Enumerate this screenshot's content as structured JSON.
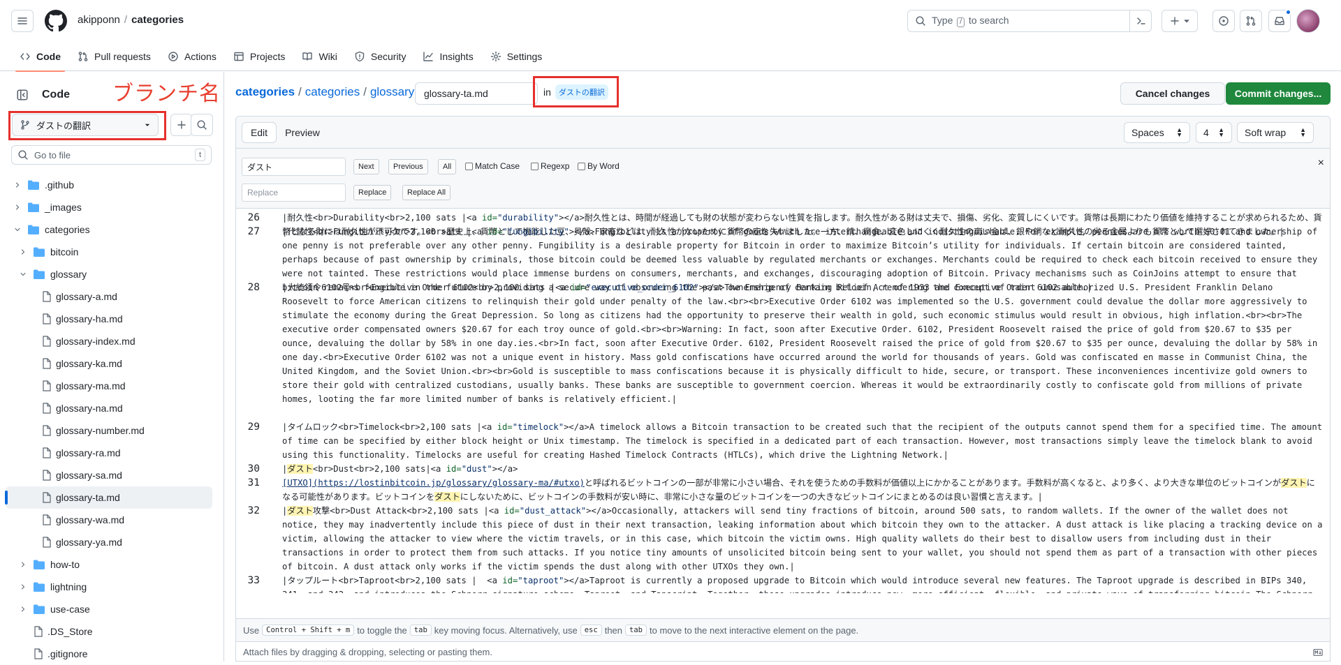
{
  "header": {
    "owner": "akipponn",
    "repo": "categories",
    "search_placeholder_pre": "Type",
    "search_key": "/",
    "search_placeholder_post": "to search"
  },
  "nav": [
    {
      "label": "Code",
      "icon": "code-icon",
      "active": true
    },
    {
      "label": "Pull requests",
      "icon": "pull-request-icon"
    },
    {
      "label": "Actions",
      "icon": "play-icon"
    },
    {
      "label": "Projects",
      "icon": "table-icon"
    },
    {
      "label": "Wiki",
      "icon": "book-icon"
    },
    {
      "label": "Security",
      "icon": "shield-icon"
    },
    {
      "label": "Insights",
      "icon": "graph-icon"
    },
    {
      "label": "Settings",
      "icon": "gear-icon"
    }
  ],
  "sidebar": {
    "title": "Code",
    "annotation": "ブランチ名",
    "branch": "ダストの翻訳",
    "goto_placeholder": "Go to file",
    "goto_key": "t",
    "tree": [
      {
        "label": ".github",
        "type": "dir",
        "depth": 0,
        "open": false
      },
      {
        "label": "_images",
        "type": "dir",
        "depth": 0,
        "open": false
      },
      {
        "label": "categories",
        "type": "dir",
        "depth": 0,
        "open": true
      },
      {
        "label": "bitcoin",
        "type": "dir",
        "depth": 1,
        "open": false
      },
      {
        "label": "glossary",
        "type": "dir",
        "depth": 1,
        "open": true
      },
      {
        "label": "glossary-a.md",
        "type": "file",
        "depth": 2
      },
      {
        "label": "glossary-ha.md",
        "type": "file",
        "depth": 2
      },
      {
        "label": "glossary-index.md",
        "type": "file",
        "depth": 2
      },
      {
        "label": "glossary-ka.md",
        "type": "file",
        "depth": 2
      },
      {
        "label": "glossary-ma.md",
        "type": "file",
        "depth": 2
      },
      {
        "label": "glossary-na.md",
        "type": "file",
        "depth": 2
      },
      {
        "label": "glossary-number.md",
        "type": "file",
        "depth": 2
      },
      {
        "label": "glossary-ra.md",
        "type": "file",
        "depth": 2
      },
      {
        "label": "glossary-sa.md",
        "type": "file",
        "depth": 2
      },
      {
        "label": "glossary-ta.md",
        "type": "file",
        "depth": 2,
        "selected": true
      },
      {
        "label": "glossary-wa.md",
        "type": "file",
        "depth": 2
      },
      {
        "label": "glossary-ya.md",
        "type": "file",
        "depth": 2
      },
      {
        "label": "how-to",
        "type": "dir",
        "depth": 1,
        "open": false
      },
      {
        "label": "lightning",
        "type": "dir",
        "depth": 1,
        "open": false
      },
      {
        "label": "use-case",
        "type": "dir",
        "depth": 1,
        "open": false
      },
      {
        "label": ".DS_Store",
        "type": "file",
        "depth": 1
      },
      {
        "label": ".gitignore",
        "type": "file",
        "depth": 1
      }
    ]
  },
  "main": {
    "breadcrumbs": [
      "categories",
      "categories",
      "glossary"
    ],
    "filename": "glossary-ta.md",
    "in_label": "in",
    "branch_chip": "ダストの翻訳",
    "cancel_label": "Cancel changes",
    "commit_label": "Commit changes..."
  },
  "editor": {
    "tab_edit": "Edit",
    "tab_preview": "Preview",
    "indent_mode": "Spaces",
    "indent_size": "4",
    "wrap_mode": "Soft wrap",
    "find": {
      "value": "ダスト",
      "replace_placeholder": "Replace",
      "next": "Next",
      "previous": "Previous",
      "all": "All",
      "match_case": "Match Case",
      "regexp": "Regexp",
      "by_word": "By Word",
      "replace": "Replace",
      "replace_all": "Replace All",
      "close": "×"
    },
    "lines": [
      {
        "n": "26",
        "parts": [
          [
            "t",
            "|耐久性<br>Durability<br>2,100 sats |<a "
          ],
          [
            "a",
            "id="
          ],
          [
            "s",
            "\"durability\""
          ],
          [
            "t",
            "></a>耐久性とは、時間が経過しても財の状態が変わらない性質を指します。耐久性がある財は丈夫で、損傷、劣化、変質しにくいです。貨幣は長期にわたり価値を維持することが求められるため、貨幣となる財には耐久性が不可欠です。<br>歴史上、貨幣として機能した豆、貝殻、家畜などは、耐久性がないために貨幣の座を失いました。一方、錆、腐食、変色しにくく耐久性の高い金は、銀や銅など耐久性の劣る金属よりも貨幣として選好されてきました。|"
          ]
        ]
      },
      {
        "n": "27",
        "parts": [
          [
            "t",
            "|代替性<br>Fungibility<br>2,100 sats |<a "
          ],
          [
            "a",
            "id="
          ],
          [
            "s",
            "\"fungibility\""
          ],
          [
            "t",
            "></a>Fungibility is a property of goods which are interchangeable and indistinguishable. For example, pennies are all worth $0.01 and ownership of one penny is not preferable over any other penny. Fungibility is a desirable property for Bitcoin in order to maximize Bitcoin’s utility for individuals. If certain bitcoin are considered tainted, perhaps because of past ownership by criminals, those bitcoin could be deemed less valuable by regulated merchants or exchanges. Merchants could be required to check each bitcoin received to ensure they were not tainted. These restrictions would place immense burdens on consumers, merchants, and exchanges, discouraging adoption of Bitcoin. Privacy mechanisms such as CoinJoins attempt to ensure that bitcoin remains fungible in the future by providing a secure way of obscuring the past ownership of certain bitcoin, rendering the concept of taint unusable.|"
          ]
        ]
      },
      {
        "n": "28",
        "parts": [
          [
            "t",
            "|大統領令6102号<br>Executive Order 6102<br>2,100 sats |<a "
          ],
          [
            "a",
            "id="
          ],
          [
            "s",
            "\"executive_order_6102\""
          ],
          [
            "t",
            "></a>The Emergency Banking Relief Act of 1933 and Executive Order 6102 authorized U.S. President Franklin Delano Roosevelt to force American citizens to relinquish their gold under penalty of the law.<br><br>Executive Order 6102 was implemented so the U.S. government could devalue the dollar more aggressively to stimulate the economy during the Great Depression. So long as citizens had the opportunity to preserve their wealth in gold, such economic stimulus would result in obvious, high inflation.<br><br>The executive order compensated owners $20.67 for each troy ounce of gold.<br><br>Warning: In fact, soon after Executive Order. 6102, President Roosevelt raised the price of gold from $20.67 to $35 per ounce, devaluing the dollar by 58% in one day.ies.<br>In fact, soon after Executive Order. 6102, President Roosevelt raised the price of gold from $20.67 to $35 per ounce, devaluing the dollar by 58% in one day.<br>Executive Order 6102 was not a unique event in history. Mass gold confiscations have occurred around the world for thousands of years. Gold was confiscated en masse in Communist China, the United Kingdom, and the Soviet Union.<br><br>Gold is susceptible to mass confiscations because it is physically difficult to hide, secure, or transport. These inconveniences incentivize gold owners to store their gold with centralized custodians, usually banks. These banks are susceptible to government coercion. Whereas it would be extraordinarily costly to confiscate gold from millions of private homes, looting the far more limited number of banks is relatively efficient.|"
          ]
        ]
      },
      {
        "n": "29",
        "parts": [
          [
            "t",
            "|タイムロック<br>Timelock<br>2,100 sats |<a "
          ],
          [
            "a",
            "id="
          ],
          [
            "s",
            "\"timelock\""
          ],
          [
            "t",
            "></a>A timelock allows a Bitcoin transaction to be created such that the recipient of the outputs cannot spend them for a specified time. The amount of time can be specified by either block height or Unix timestamp. The timelock is specified in a dedicated part of each transaction. However, most transactions simply leave the timelock blank to avoid using this functionality. Timelocks are useful for creating Hashed Timelock Contracts (HTLCs), which drive the Lightning Network.|"
          ]
        ]
      },
      {
        "n": "30",
        "parts": [
          [
            "t",
            "|"
          ],
          [
            "h",
            "ダスト"
          ],
          [
            "t",
            "<br>Dust<br>2,100 sats|<a "
          ],
          [
            "a",
            "id="
          ],
          [
            "s",
            "\"dust\""
          ],
          [
            "t",
            "></a>"
          ]
        ]
      },
      {
        "n": "31",
        "parts": [
          [
            "l",
            "[UTXO](https://lostinbitcoin.jp/glossary/glossary-ma/#utxo)"
          ],
          [
            "t",
            "と呼ばれるビットコインの一部が非常に小さい場合、それを使うための手数料が価値以上にかかることがあります。手数料が高くなると、より多く、より大きな単位のビットコインが"
          ],
          [
            "h",
            "ダスト"
          ],
          [
            "t",
            "になる可能性があります。ビットコインを"
          ],
          [
            "h",
            "ダスト"
          ],
          [
            "t",
            "にしないために、ビットコインの手数料が安い時に、非常に小さな量のビットコインを一つの大きなビットコインにまとめるのは良い習慣と言えます。|"
          ]
        ]
      },
      {
        "n": "32",
        "parts": [
          [
            "t",
            "|"
          ],
          [
            "h",
            "ダスト"
          ],
          [
            "t",
            "攻撃<br>Dust Attack<br>2,100 sats |<a "
          ],
          [
            "a",
            "id="
          ],
          [
            "s",
            "\"dust_attack\""
          ],
          [
            "t",
            "></a>Occasionally, attackers will send tiny fractions of bitcoin, around 500 sats, to random wallets. If the owner of the wallet does not notice, they may inadvertently include this piece of dust in their next transaction, leaking information about which bitcoin they own to the attacker. A dust attack is like placing a tracking device on a victim, allowing the attacker to view where the victim travels, or in this case, which bitcoin the victim owns. High quality wallets do their best to disallow users from including dust in their transactions in order to protect them from such attacks. If you notice tiny amounts of unsolicited bitcoin being sent to your wallet, you should not spend them as part of a transaction with other pieces of bitcoin. A dust attack only works if the victim spends the dust along with other UTXOs they own.|"
          ]
        ]
      },
      {
        "n": "33",
        "parts": [
          [
            "t",
            "|タップルート<br>Taproot<br>2,100 sats |  <a "
          ],
          [
            "a",
            "id="
          ],
          [
            "s",
            "\"taproot\""
          ],
          [
            "t",
            "></a>Taproot is currently a proposed upgrade to Bitcoin which would introduce several new features. The Taproot upgrade is described in BIPs 340, 341, and 342, and introduces the Schnorr signature scheme, Taproot, and Tapscript. Together, these upgrades introduce new, more efficient, flexible, and private ways of transferring bitcoin.The Schnorr signature scheme will allow users to aggregate multiple signatures into one for a single transaction."
          ]
        ]
      }
    ],
    "hint": {
      "t1": "Use",
      "k1": "Control + Shift + m",
      "t2": "to toggle the",
      "k2": "tab",
      "t3": "key moving focus. Alternatively, use",
      "k3": "esc",
      "t4": "then",
      "k4": "tab",
      "t5": "to move to the next interactive element on the page."
    },
    "attach": "Attach files by dragging & dropping, selecting or pasting them."
  },
  "colors": {
    "accent": "#0969da",
    "commit_green": "#1f883d",
    "annotation_red": "#e5302c",
    "highlight": "#fff4b1"
  }
}
